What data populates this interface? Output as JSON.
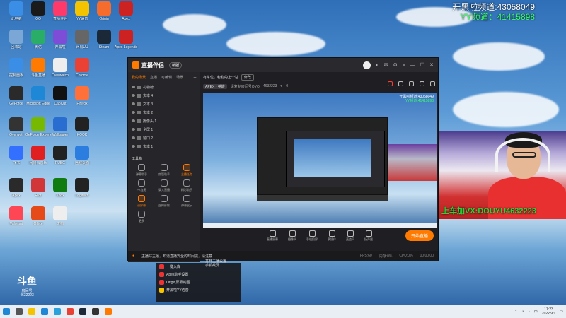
{
  "overlay": {
    "line1": "开黑啦频道:43058049",
    "line2": "YY频道：41415898"
  },
  "desktop_icons": [
    {
      "label": "此电脑",
      "icon": "computer-icon",
      "color": "#3a8ee6"
    },
    {
      "label": "QQ",
      "icon": "qq-icon",
      "color": "#1a1a1a"
    },
    {
      "label": "直播伴侣",
      "icon": "live-icon",
      "color": "#ff3a6a"
    },
    {
      "label": "YY语音",
      "icon": "yy-icon",
      "color": "#f5c400"
    },
    {
      "label": "Origin",
      "icon": "origin-icon",
      "color": "#f56c2d"
    },
    {
      "label": "Apex",
      "icon": "apex-icon",
      "color": "#c22"
    },
    {
      "label": "回收站",
      "icon": "recycle-bin-icon",
      "color": "#7aa7d6"
    },
    {
      "label": "微信",
      "icon": "wechat-icon",
      "color": "#2aae67"
    },
    {
      "label": "开黑啦",
      "icon": "kaiheila-icon",
      "color": "#7e4dd8"
    },
    {
      "label": "网易UU",
      "icon": "uu-icon",
      "color": "#666"
    },
    {
      "label": "Steam",
      "icon": "steam-icon",
      "color": "#1b2838"
    },
    {
      "label": "Apex Legends",
      "icon": "apex-legends-icon",
      "color": "#c22"
    },
    {
      "label": "控制面板",
      "icon": "control-panel-icon",
      "color": "#3a8ee6"
    },
    {
      "label": "斗鱼直播",
      "icon": "douyu-icon",
      "color": "#ff7a00"
    },
    {
      "label": "Overwatch",
      "icon": "overwatch-icon",
      "color": "#eee"
    },
    {
      "label": "Chrome",
      "icon": "chrome-icon",
      "color": "#e94235"
    },
    {
      "label": "GeForce",
      "icon": "geforce-icon",
      "color": "#2a2a2a"
    },
    {
      "label": "Microsoft Edge",
      "icon": "edge-icon",
      "color": "#1e88d6"
    },
    {
      "label": "CapCut",
      "icon": "capcut-icon",
      "color": "#111"
    },
    {
      "label": "Firefox",
      "icon": "firefox-icon",
      "color": "#ff7139"
    },
    {
      "label": "Overwolf",
      "icon": "overwolf-icon",
      "color": "#333"
    },
    {
      "label": "GeForce Experience",
      "icon": "nvidia-icon",
      "color": "#76b900"
    },
    {
      "label": "Wallpaper",
      "icon": "wallpaper-icon",
      "color": "#2a6dd1"
    },
    {
      "label": "KOOK",
      "icon": "kook-icon",
      "color": "#222"
    },
    {
      "label": "飞书",
      "icon": "feishu-icon",
      "color": "#3370ff"
    },
    {
      "label": "网易云音乐",
      "icon": "netease-music-icon",
      "color": "#e02020"
    },
    {
      "label": "PUBG",
      "icon": "pubg-icon",
      "color": "#222"
    },
    {
      "label": "远程桌面",
      "icon": "remote-icon",
      "color": "#2b7de0"
    },
    {
      "label": "Apex",
      "icon": "apex-small-icon",
      "color": "#2a2a2a"
    },
    {
      "label": "Riot",
      "icon": "riot-icon",
      "color": "#d13639"
    },
    {
      "label": "Xbox",
      "icon": "xbox-icon",
      "color": "#107c10"
    },
    {
      "label": "Logitech",
      "icon": "logitech-icon",
      "color": "#222"
    },
    {
      "label": "Valorant",
      "icon": "valorant-icon",
      "color": "#ff4655"
    },
    {
      "label": "Office",
      "icon": "office-icon",
      "color": "#e64a19"
    },
    {
      "label": "文档",
      "icon": "document-icon",
      "color": "#eee"
    }
  ],
  "app": {
    "name": "直播伴侣",
    "version_badge": "新版",
    "tabs": [
      "我的场景",
      "直播",
      "可编辑",
      "场景"
    ],
    "sources": [
      {
        "label": "礼物榜"
      },
      {
        "label": "文本 4"
      },
      {
        "label": "文本 3"
      },
      {
        "label": "文本 2"
      },
      {
        "label": "摄像头 1"
      },
      {
        "label": "全屏 1"
      },
      {
        "label": "窗口 2"
      },
      {
        "label": "文本 1"
      }
    ],
    "tools_title": "工具箱",
    "tools": [
      {
        "label": "弹幕助手",
        "active": false
      },
      {
        "label": "房管助手",
        "active": false
      },
      {
        "label": "主播任务",
        "active": true
      },
      {
        "label": "PK连麦",
        "active": false
      },
      {
        "label": "录入直播",
        "active": false
      },
      {
        "label": "精彩助手",
        "active": false
      },
      {
        "label": "录屏幕",
        "active": true
      },
      {
        "label": "虚拟形象",
        "active": false
      },
      {
        "label": "弹幕展示",
        "active": false
      },
      {
        "label": "更多",
        "active": false
      }
    ],
    "room_title": "有车位，稳稳的上个钻",
    "room_edit": "修改",
    "category_tag": "APEX - 英雄",
    "room_id_text": "请复制房间号QYQ",
    "room_number": "4632223",
    "fans": "0",
    "preview_overlay_1": "开黑啦频道:43058049",
    "preview_overlay_2": "YY频道:41415898",
    "bottom_tools": [
      "直播屏幕",
      "摄像头",
      "手机投屏",
      "多媒体",
      "麦克风",
      "扬声器"
    ],
    "start_button": "开始直播",
    "status_warning": "主播好主播，知道直播安全的时间提，请注意",
    "status_items": [
      "FPS:60",
      "内存:0%",
      "CPU:0%"
    ],
    "status_time": "00:00:00"
  },
  "webcam": {
    "caption": "上车加VX:DOUYU4632223"
  },
  "popup_items": [
    {
      "label": "一键入库"
    },
    {
      "label": "Apex助手设置"
    },
    {
      "label": "Origin屏幕截图"
    },
    {
      "label": "开黑啦YY语音"
    }
  ],
  "popup_side_items": [
    {
      "label": "打开主播设置"
    },
    {
      "label": "手机截屏"
    }
  ],
  "bottom_left_badge": {
    "line1": "斗鱼",
    "line2": "房间号",
    "line3": "4632223"
  },
  "taskbar": {
    "time": "17:23",
    "date": "2022/9/1",
    "lang": "中",
    "items": [
      {
        "icon": "windows-start-icon",
        "color": "#1e88d6"
      },
      {
        "icon": "search-icon",
        "color": "#555"
      },
      {
        "icon": "file-explorer-icon",
        "color": "#f5c400"
      },
      {
        "icon": "edge-taskbar-icon",
        "color": "#1e88d6"
      },
      {
        "icon": "telegram-icon",
        "color": "#2aa1da"
      },
      {
        "icon": "chrome-taskbar-icon",
        "color": "#e94235"
      },
      {
        "icon": "steam-taskbar-icon",
        "color": "#1b2838"
      },
      {
        "icon": "obs-icon",
        "color": "#333"
      },
      {
        "icon": "douyu-taskbar-icon",
        "color": "#ff7a00"
      }
    ]
  }
}
